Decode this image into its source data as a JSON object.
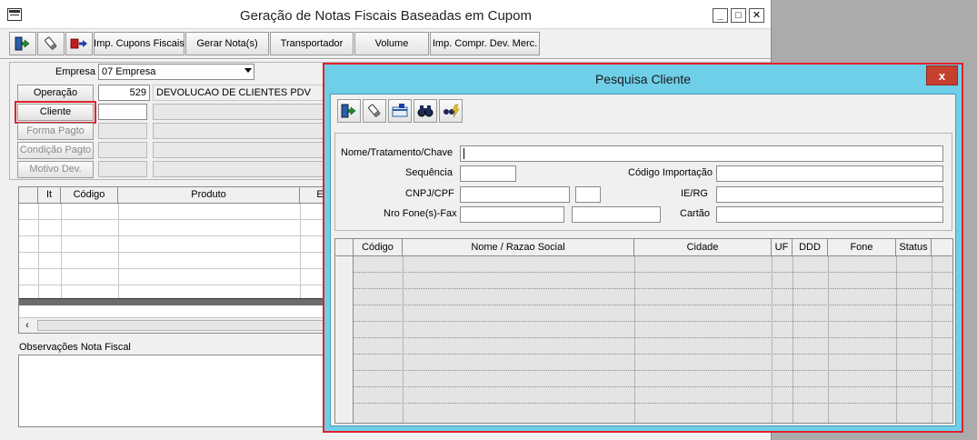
{
  "main_window": {
    "title": "Geração de Notas Fiscais Baseadas em Cupom",
    "controls": {
      "minimize": "_",
      "maximize": "□",
      "close": "✕"
    },
    "toolbar": {
      "icons": [
        "exit-door-icon",
        "eraser-icon",
        "exit-arrow-icon"
      ],
      "buttons": [
        "Imp. Cupons Fiscais",
        "Gerar Nota(s)",
        "Transportador",
        "Volume",
        "Imp. Compr. Dev. Merc."
      ]
    },
    "form": {
      "empresa_label": "Empresa",
      "empresa_value": "07 Empresa",
      "operacao_label": "Operação",
      "operacao_code": "529",
      "operacao_desc": "DEVOLUCAO DE CLIENTES PDV",
      "cliente_label": "Cliente",
      "cliente_value": "",
      "forma_pagto_label": "Forma Pagto",
      "condicao_pagto_label": "Condição Pagto",
      "motivo_dev_label": "Motivo Dev."
    },
    "items_grid": {
      "columns": [
        "It",
        "Código",
        "Produto",
        "E"
      ]
    },
    "observacoes_label": "Observações Nota Fiscal"
  },
  "dialog": {
    "title": "Pesquisa Cliente",
    "close": "x",
    "toolbar_icons": [
      "exit-door-icon",
      "eraser-icon",
      "card-icon",
      "binoculars-icon",
      "search-lightning-icon"
    ],
    "fields": {
      "nome_label": "Nome/Tratamento/Chave",
      "sequencia_label": "Sequência",
      "codigo_importacao_label": "Código Importação",
      "cnpj_label": "CNPJ/CPF",
      "ie_label": "IE/RG",
      "fone_label": "Nro Fone(s)-Fax",
      "cartao_label": "Cartão"
    },
    "results_grid": {
      "columns": [
        "Código",
        "Nome / Razao Social",
        "Cidade",
        "UF",
        "DDD",
        "Fone",
        "Status"
      ]
    }
  },
  "colors": {
    "dialog_title_bg": "#6fcfe9",
    "highlight_red": "#e0222b",
    "close_button": "#c7402f"
  }
}
